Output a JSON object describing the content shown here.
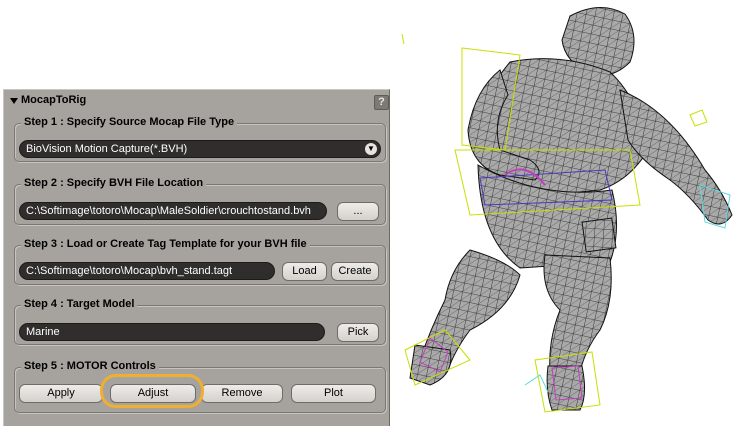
{
  "panel": {
    "title": "MocapToRig",
    "help_label": "?",
    "step1": {
      "title": "Step 1 : Specify Source Mocap File Type",
      "dropdown_value": "BioVision Motion Capture(*.BVH)"
    },
    "step2": {
      "title": "Step 2 : Specify BVH File Location",
      "path_value": "C:\\Softimage\\totoro\\Mocap\\MaleSoldier\\crouchtostand.bvh",
      "browse_label": "..."
    },
    "step3": {
      "title": "Step 3 : Load or Create Tag Template for your BVH file",
      "template_value": "C:\\Softimage\\totoro\\Mocap\\bvh_stand.tagt",
      "load_label": "Load",
      "create_label": "Create"
    },
    "step4": {
      "title": "Step 4 : Target Model",
      "model_value": "Marine",
      "pick_label": "Pick"
    },
    "step5": {
      "title": "Step 5 : MOTOR Controls",
      "apply_label": "Apply",
      "adjust_label": "Adjust",
      "remove_label": "Remove",
      "plot_label": "Plot"
    }
  },
  "colors": {
    "panel_bg": "#a6a39e",
    "field_bg": "#2f2e2c",
    "highlight": "#f2ae30",
    "mesh_fill": "#a9a9a9",
    "rig_yellow": "#c8e000",
    "rig_purple": "#c040c0",
    "rig_cyan": "#60d8e0"
  }
}
